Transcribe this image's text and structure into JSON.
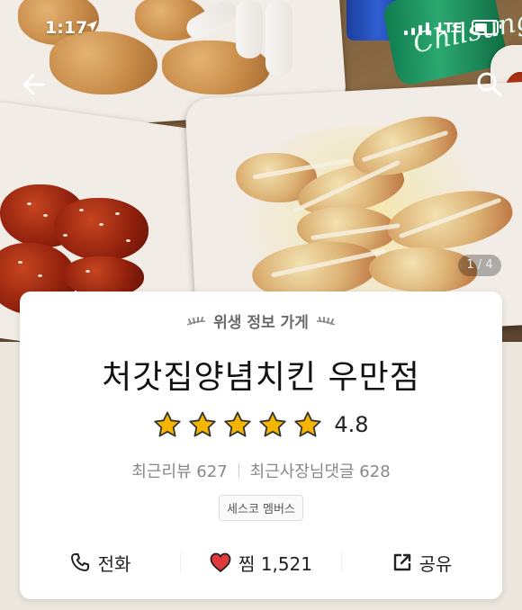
{
  "status_bar": {
    "time": "1:17",
    "network": "LTE",
    "location_icon": "location-arrow-icon",
    "battery_fill": 0.5
  },
  "nav": {
    "back_icon": "back-arrow-icon",
    "search_icon": "search-icon"
  },
  "photo": {
    "counter": "1 / 4"
  },
  "store": {
    "badge": "위생 정보 가게",
    "name": "처갓집양념치킨 우만점",
    "rating": "4.8",
    "stars_filled": 5,
    "recent_reviews": "최근리뷰 627",
    "owner_replies": "최근사장님댓글 628",
    "tag": "세스코 멤버스"
  },
  "actions": [
    {
      "icon": "phone-icon",
      "label": "전화"
    },
    {
      "icon": "heart-icon",
      "label": "찜 1,521"
    },
    {
      "icon": "share-icon",
      "label": "공유"
    }
  ],
  "colors": {
    "star": "#f4b400",
    "heart": "#e03a3a",
    "accent_text": "#111111"
  }
}
